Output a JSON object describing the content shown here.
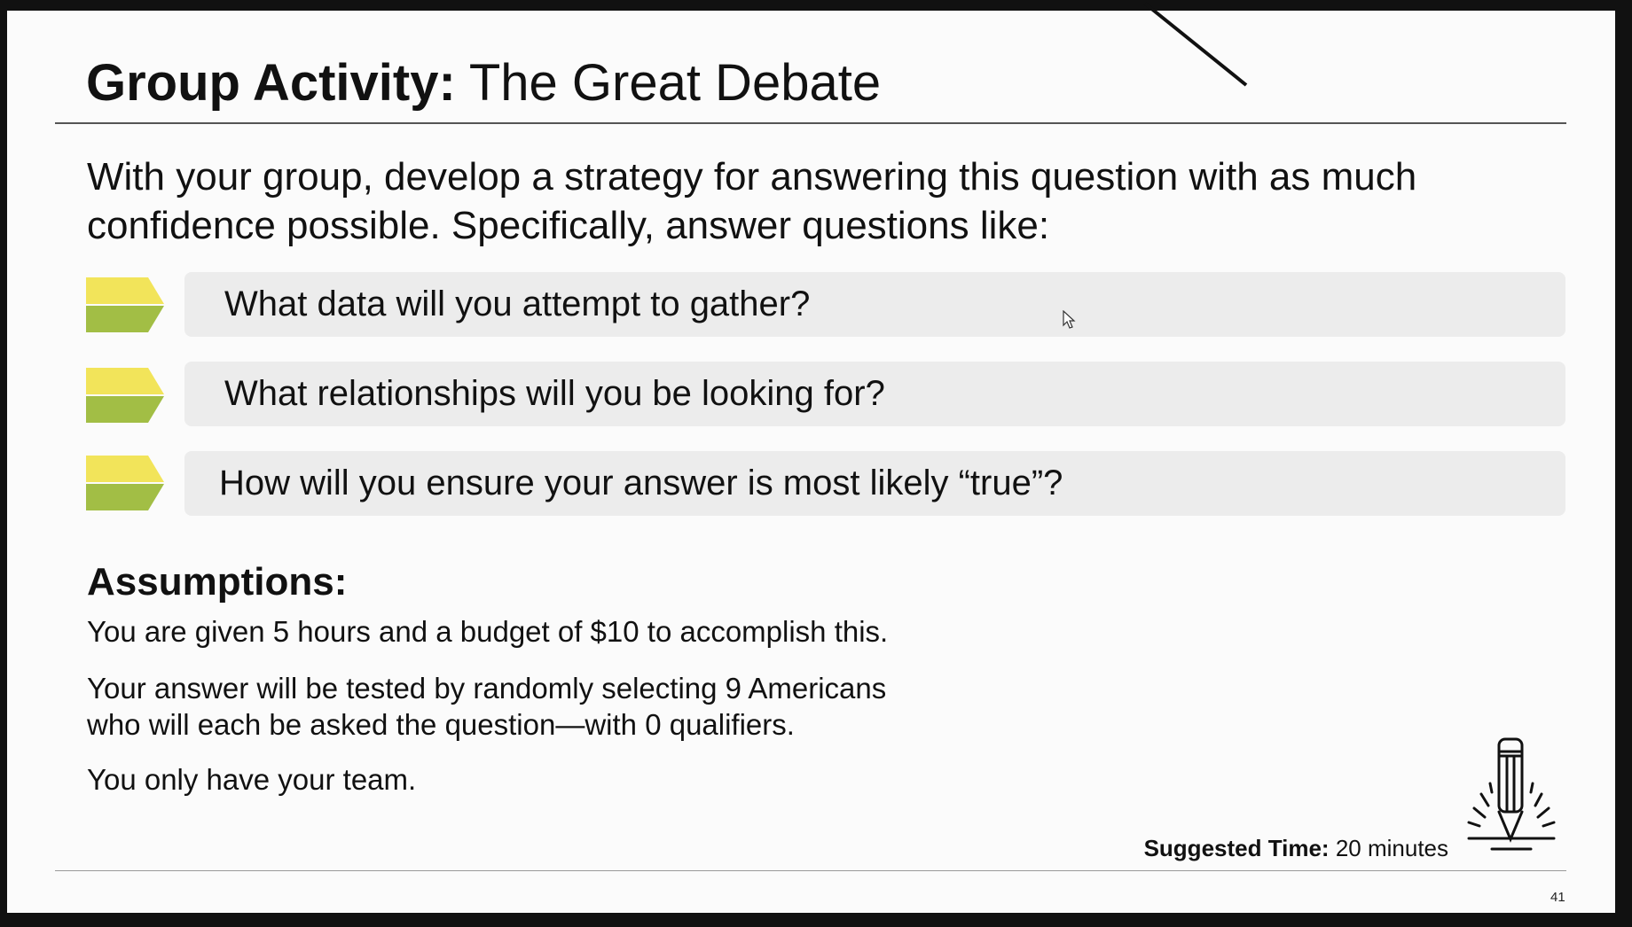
{
  "slide": {
    "title_bold": "Group Activity:",
    "title_rest": " The Great Debate",
    "intro": "With your group, develop a strategy for answering this question with as much confidence possible. Specifically, answer questions like:",
    "questions": [
      {
        "text": "What data will you attempt to gather?"
      },
      {
        "text": "What relationships will you be looking for?"
      },
      {
        "text": "How will you ensure your answer is most likely “true”?"
      }
    ],
    "assumptions_heading": "Assumptions:",
    "assumptions": [
      "You are given 5 hours and a budget of $10 to accomplish this.",
      "Your answer will be tested by randomly selecting 9 Americans",
      "who will each be asked the question—with 0 qualifiers.",
      "You only have your team."
    ],
    "suggested_time_label": "Suggested Time:",
    "suggested_time_value": " 20 minutes",
    "page_number": "41",
    "colors": {
      "arrow_top": "#f2e45a",
      "arrow_bottom": "#a2be45",
      "row_bg": "#ececec"
    },
    "icons": [
      "pencil-icon",
      "mouse-cursor-icon"
    ]
  }
}
